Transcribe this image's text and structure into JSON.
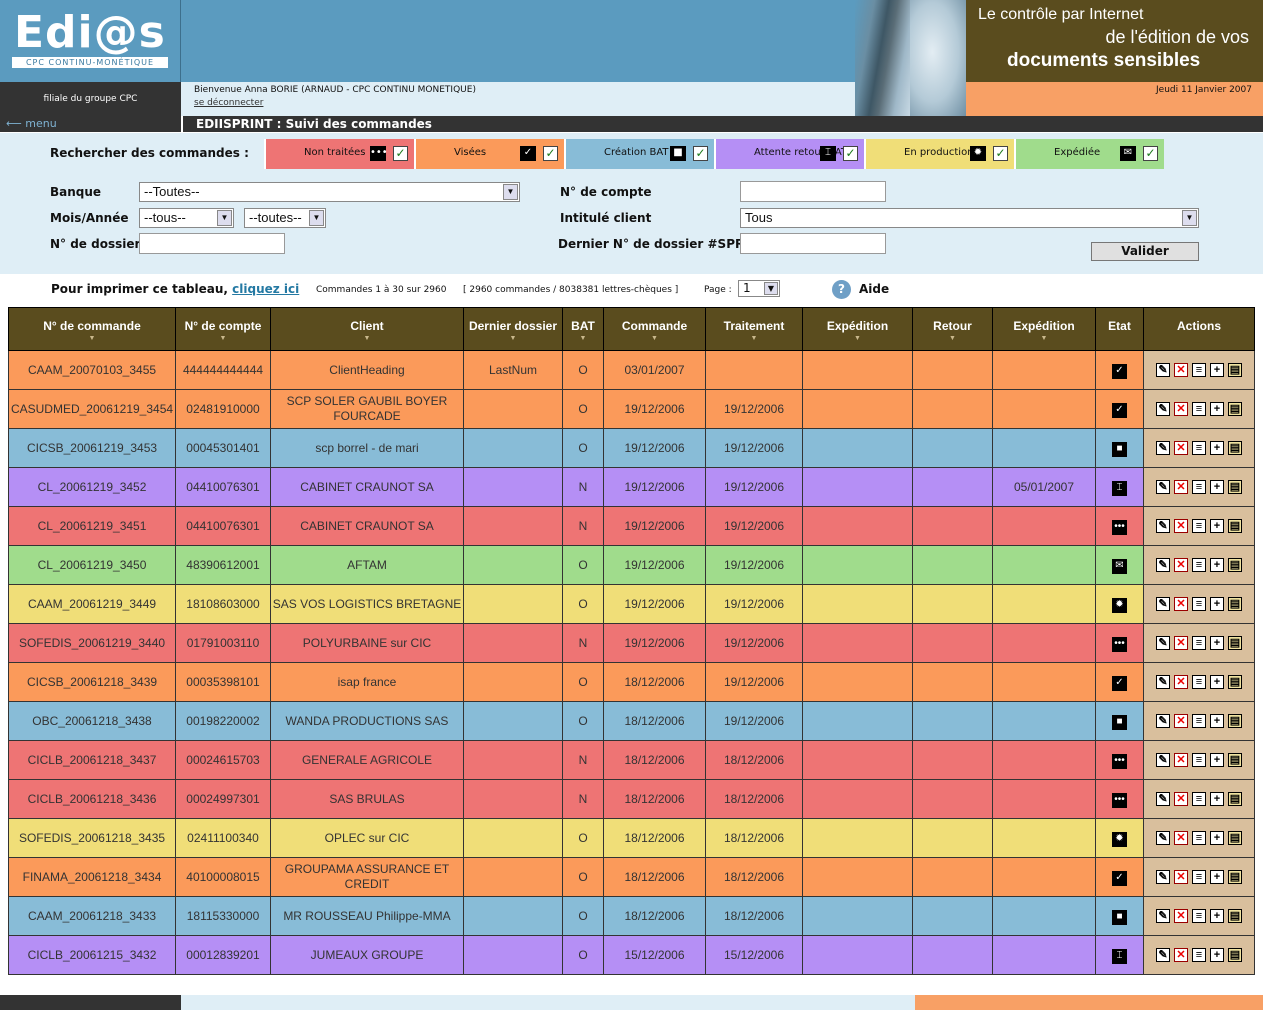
{
  "header": {
    "logo_text": "Edi@s",
    "logo_sub": "CPC CONTINU-MONÉTIQUE",
    "filiale": "filiale du groupe CPC",
    "welcome": "Bienvenue Anna BORIE (ARNAUD - CPC CONTINU MONETIQUE)",
    "logout": "se déconnecter",
    "tagline1": "Le contrôle par Internet",
    "tagline2": "de l'édition de vos",
    "tagline3": "documents sensibles",
    "date": "Jeudi 11 Janvier 2007",
    "menu": "menu",
    "title": "EDIISPRINT : Suivi des commandes"
  },
  "search": {
    "label": "Rechercher des commandes :",
    "tabs": [
      {
        "label": "Non traitées",
        "icon": "dots-icon",
        "glyph": "•••",
        "color": "#ee7474"
      },
      {
        "label": "Visées",
        "icon": "check-icon",
        "glyph": "✓",
        "color": "#fb9a5a"
      },
      {
        "label": "Création BAT",
        "icon": "square-icon",
        "glyph": "■",
        "color": "#88bcd7"
      },
      {
        "label": "Attente retour BAT",
        "icon": "bat-icon",
        "glyph": "⌶",
        "color": "#b58ff5"
      },
      {
        "label": "En production",
        "icon": "gear-icon",
        "glyph": "✹",
        "color": "#f0de78"
      },
      {
        "label": "Expédiée",
        "icon": "envelope-icon",
        "glyph": "✉",
        "color": "#a0dc8c"
      }
    ]
  },
  "filters": {
    "banque_label": "Banque",
    "banque_value": "--Toutes--",
    "mois_label": "Mois/Année",
    "mois_value": "--tous--",
    "annee_value": "--toutes--",
    "dossier_label": "N° de dossier",
    "dossier_value": "",
    "compte_label": "N° de compte",
    "compte_value": "",
    "intitule_label": "Intitulé client",
    "intitule_value": "Tous",
    "dernier_label": "Dernier N° de dossier #SPR#",
    "dernier_value": "",
    "valider": "Valider"
  },
  "print": {
    "text": "Pour imprimer ce tableau, ",
    "link": "cliquez ici",
    "range": "Commandes 1 à 30 sur 2960",
    "summary": "[ 2960 commandes / 8038381 lettres-chèques ]",
    "page_label": "Page :",
    "page_value": "1",
    "help_glyph": "?",
    "help": "Aide"
  },
  "table": {
    "headers": [
      "N° de commande",
      "N° de compte",
      "Client",
      "Dernier dossier",
      "BAT",
      "Commande",
      "Traitement",
      "Expédition",
      "Retour",
      "Expédition",
      "Etat",
      "Actions"
    ],
    "rows": [
      {
        "state": "vi",
        "cmd": "CAAM_20070103_3455",
        "compte": "444444444444",
        "client": "ClientHeading",
        "dernier": "LastNum",
        "bat": "O",
        "commande": "03/01/2007",
        "traitement": "",
        "expedition": "",
        "retour": "",
        "expedition2": "",
        "etat": "check-icon"
      },
      {
        "state": "vi",
        "cmd": "CASUDMED_20061219_3454",
        "compte": "02481910000",
        "client": "SCP SOLER GAUBIL BOYER FOURCADE",
        "dernier": "",
        "bat": "O",
        "commande": "19/12/2006",
        "traitement": "19/12/2006",
        "expedition": "",
        "retour": "",
        "expedition2": "",
        "etat": "check-icon"
      },
      {
        "state": "cb",
        "cmd": "CICSB_20061219_3453",
        "compte": "00045301401",
        "client": "scp borrel - de mari",
        "dernier": "",
        "bat": "O",
        "commande": "19/12/2006",
        "traitement": "19/12/2006",
        "expedition": "",
        "retour": "",
        "expedition2": "",
        "etat": "square-icon"
      },
      {
        "state": "ab",
        "cmd": "CL_20061219_3452",
        "compte": "04410076301",
        "client": "CABINET CRAUNOT SA",
        "dernier": "",
        "bat": "N",
        "commande": "19/12/2006",
        "traitement": "19/12/2006",
        "expedition": "",
        "retour": "",
        "expedition2": "05/01/2007",
        "etat": "bat-icon"
      },
      {
        "state": "nt",
        "cmd": "CL_20061219_3451",
        "compte": "04410076301",
        "client": "CABINET CRAUNOT SA",
        "dernier": "",
        "bat": "N",
        "commande": "19/12/2006",
        "traitement": "19/12/2006",
        "expedition": "",
        "retour": "",
        "expedition2": "",
        "etat": "dots-icon"
      },
      {
        "state": "ex",
        "cmd": "CL_20061219_3450",
        "compte": "48390612001",
        "client": "AFTAM",
        "dernier": "",
        "bat": "O",
        "commande": "19/12/2006",
        "traitement": "19/12/2006",
        "expedition": "",
        "retour": "",
        "expedition2": "",
        "etat": "envelope-icon"
      },
      {
        "state": "pr",
        "cmd": "CAAM_20061219_3449",
        "compte": "18108603000",
        "client": "SAS VOS LOGISTICS BRETAGNE",
        "dernier": "",
        "bat": "O",
        "commande": "19/12/2006",
        "traitement": "19/12/2006",
        "expedition": "",
        "retour": "",
        "expedition2": "",
        "etat": "gear-icon"
      },
      {
        "state": "nt",
        "cmd": "SOFEDIS_20061219_3440",
        "compte": "01791003110",
        "client": "POLYURBAINE sur CIC",
        "dernier": "",
        "bat": "N",
        "commande": "19/12/2006",
        "traitement": "19/12/2006",
        "expedition": "",
        "retour": "",
        "expedition2": "",
        "etat": "dots-icon"
      },
      {
        "state": "vi",
        "cmd": "CICSB_20061218_3439",
        "compte": "00035398101",
        "client": "isap france",
        "dernier": "",
        "bat": "O",
        "commande": "18/12/2006",
        "traitement": "19/12/2006",
        "expedition": "",
        "retour": "",
        "expedition2": "",
        "etat": "check-icon"
      },
      {
        "state": "cb",
        "cmd": "OBC_20061218_3438",
        "compte": "00198220002",
        "client": "WANDA PRODUCTIONS SAS",
        "dernier": "",
        "bat": "O",
        "commande": "18/12/2006",
        "traitement": "19/12/2006",
        "expedition": "",
        "retour": "",
        "expedition2": "",
        "etat": "square-icon"
      },
      {
        "state": "nt",
        "cmd": "CICLB_20061218_3437",
        "compte": "00024615703",
        "client": "GENERALE AGRICOLE",
        "dernier": "",
        "bat": "N",
        "commande": "18/12/2006",
        "traitement": "18/12/2006",
        "expedition": "",
        "retour": "",
        "expedition2": "",
        "etat": "dots-icon"
      },
      {
        "state": "nt",
        "cmd": "CICLB_20061218_3436",
        "compte": "00024997301",
        "client": "SAS BRULAS",
        "dernier": "",
        "bat": "N",
        "commande": "18/12/2006",
        "traitement": "18/12/2006",
        "expedition": "",
        "retour": "",
        "expedition2": "",
        "etat": "dots-icon"
      },
      {
        "state": "pr",
        "cmd": "SOFEDIS_20061218_3435",
        "compte": "02411100340",
        "client": "OPLEC sur CIC",
        "dernier": "",
        "bat": "O",
        "commande": "18/12/2006",
        "traitement": "18/12/2006",
        "expedition": "",
        "retour": "",
        "expedition2": "",
        "etat": "gear-icon"
      },
      {
        "state": "vi",
        "cmd": "FINAMA_20061218_3434",
        "compte": "40100008015",
        "client": "GROUPAMA ASSURANCE ET CREDIT",
        "dernier": "",
        "bat": "O",
        "commande": "18/12/2006",
        "traitement": "18/12/2006",
        "expedition": "",
        "retour": "",
        "expedition2": "",
        "etat": "check-icon"
      },
      {
        "state": "cb",
        "cmd": "CAAM_20061218_3433",
        "compte": "18115330000",
        "client": "MR ROUSSEAU Philippe-MMA",
        "dernier": "",
        "bat": "O",
        "commande": "18/12/2006",
        "traitement": "18/12/2006",
        "expedition": "",
        "retour": "",
        "expedition2": "",
        "etat": "square-icon"
      },
      {
        "state": "ab",
        "cmd": "CICLB_20061215_3432",
        "compte": "00012839201",
        "client": "JUMEAUX GROUPE",
        "dernier": "",
        "bat": "O",
        "commande": "15/12/2006",
        "traitement": "15/12/2006",
        "expedition": "",
        "retour": "",
        "expedition2": "",
        "etat": "bat-icon"
      }
    ],
    "action_icons": [
      {
        "name": "edit-icon",
        "glyph": "✎"
      },
      {
        "name": "delete-icon",
        "glyph": "✕"
      },
      {
        "name": "document-icon",
        "glyph": "≡"
      },
      {
        "name": "add-icon",
        "glyph": "+"
      },
      {
        "name": "print-icon",
        "glyph": "▤"
      }
    ]
  }
}
